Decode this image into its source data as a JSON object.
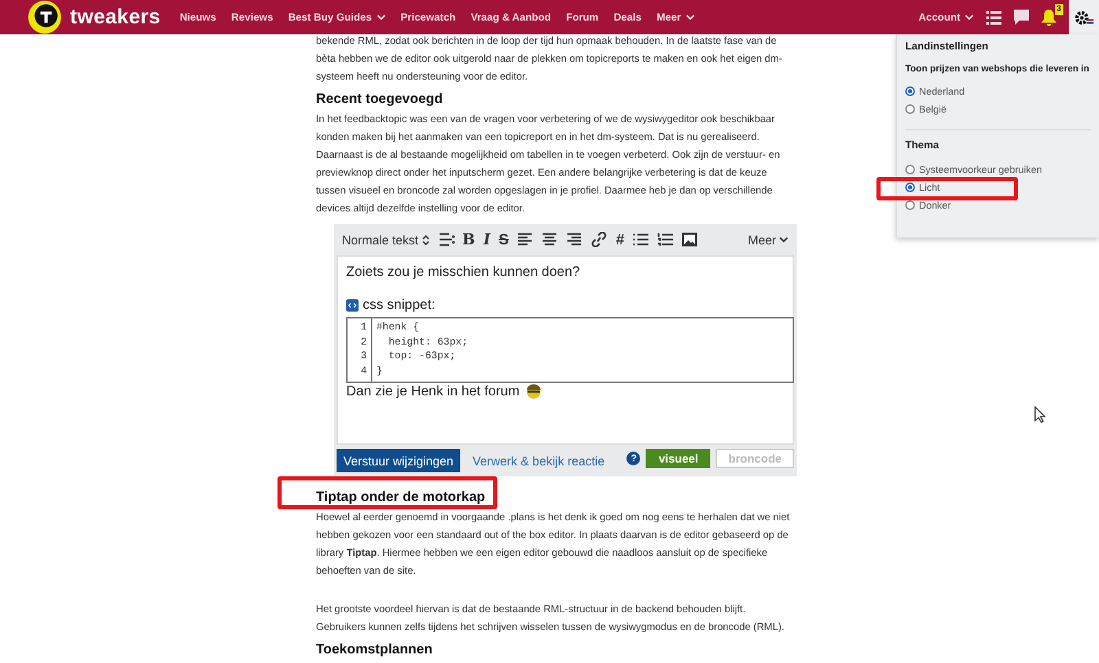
{
  "header": {
    "logo": "tweakers",
    "nav": [
      {
        "label": "Nieuws",
        "dropdown": false
      },
      {
        "label": "Reviews",
        "dropdown": false
      },
      {
        "label": "Best Buy Guides",
        "dropdown": true
      },
      {
        "label": "Pricewatch",
        "dropdown": false
      },
      {
        "label": "Vraag & Aanbod",
        "dropdown": false
      },
      {
        "label": "Forum",
        "dropdown": false
      },
      {
        "label": "Deals",
        "dropdown": false
      },
      {
        "label": "Meer",
        "dropdown": true
      }
    ],
    "account": "Account",
    "notification_count": "3",
    "settings_open": true
  },
  "article": {
    "blocks": [
      {
        "kind": "paragraph",
        "text": "bekende RML, zodat ook berichten in de loop der tijd hun opmaak behouden. In de laatste fase van de\nbèta hebben we de editor ook uitgerold naar de plekken om topicreports te maken en ook het eigen dm-\nsysteem heeft nu ondersteuning voor de editor."
      },
      {
        "kind": "heading",
        "text": "Recent toegevoegd"
      },
      {
        "kind": "paragraph",
        "text": "In het feedbacktopic was een van de vragen voor verbetering of we de wysiwygeditor ook beschikbaar\nkonden maken bij het aanmaken van een topicreport en in het dm-systeem. Dat is nu gerealiseerd.\nDaarnaast is de al bestaande mogelijkheid om tabellen in te voegen verbeterd. Ook zijn de verstuur- en\npreviewknop direct onder het inputscherm gezet. Een andere belangrijke verbetering is dat de keuze\ntussen visueel en broncode zal worden opgeslagen in je profiel. Daarmee heb je dan op verschillende\ndevices altijd dezelfde instelling voor de editor."
      },
      {
        "kind": "editor"
      },
      {
        "kind": "heading",
        "text": "Tiptap onder de motorkap"
      },
      {
        "kind": "paragraph",
        "text": "Hoewel al eerder genoemd in voorgaande .plans is het denk ik goed om nog eens te herhalen dat we niet\nhebben gekozen voor een standaard out of the box editor. In plaats daarvan is de editor gebaseerd op de\nlibrary **Tiptap**. Hiermee hebben we een eigen editor gebouwd die naadloos aansluit op de specifieke\nbehoeften van de site."
      },
      {
        "kind": "paragraph",
        "text": "Het grootste voordeel hiervan is dat de bestaande RML-structuur in de backend behouden blijft.\nGebruikers kunnen zelfs tijdens het schrijven wisselen tussen de wysiwygmodus en de broncode (RML)."
      },
      {
        "kind": "heading",
        "text": "Toekomstplannen"
      }
    ]
  },
  "editor": {
    "format": "Normale tekst",
    "glyphs": [
      "B",
      "I",
      "S"
    ],
    "hash": "#",
    "more": "Meer",
    "intro": "Zoiets zou je misschien kunnen doen?",
    "snippet_label": "css snippet:",
    "code_lines": [
      {
        "number": "1",
        "code": "#henk {"
      },
      {
        "number": "2",
        "code": "  height: 63px;"
      },
      {
        "number": "3",
        "code": "  top: -63px;"
      },
      {
        "number": "4",
        "code": "}"
      }
    ],
    "outro": "Dan zie je Henk in het forum",
    "submit": "Verstuur wijzigingen",
    "preview": "Verwerk & bekijk reactie",
    "help": "?",
    "modes": [
      {
        "label": "visueel",
        "selected": true
      },
      {
        "label": "broncode",
        "selected": false
      }
    ]
  },
  "settings": {
    "title": "Landinstellingen",
    "prompt": "Toon prijzen van webshops die leveren in",
    "countries": [
      {
        "label": "Nederland",
        "selected": true
      },
      {
        "label": "België",
        "selected": false
      }
    ],
    "theme_title": "Thema",
    "themes": [
      {
        "label": "Systeemvoorkeur gebruiken",
        "selected": false
      },
      {
        "label": "Licht",
        "selected": true
      },
      {
        "label": "Donker",
        "selected": false
      }
    ]
  }
}
